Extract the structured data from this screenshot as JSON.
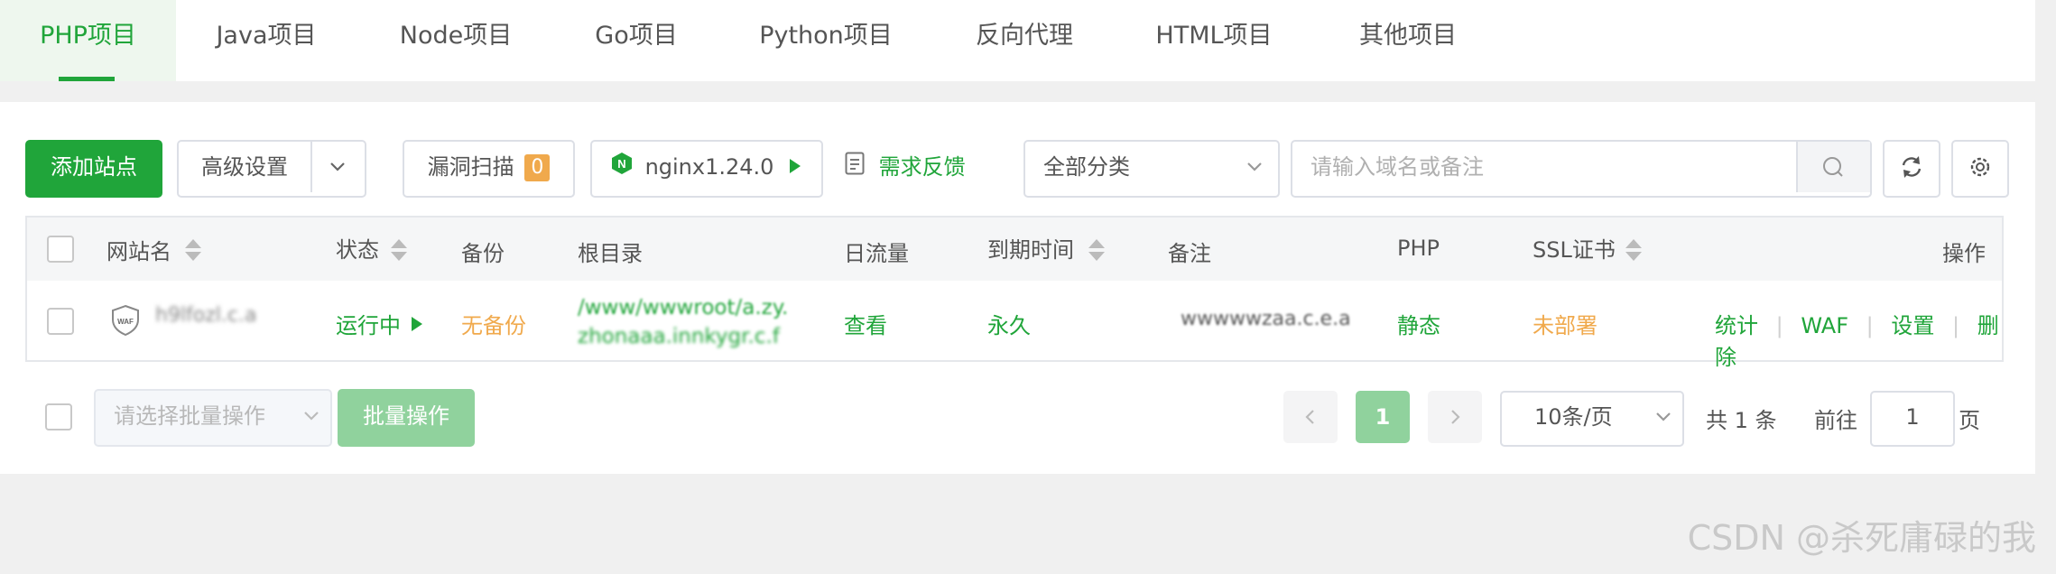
{
  "tabs": [
    "PHP项目",
    "Java项目",
    "Node项目",
    "Go项目",
    "Python项目",
    "反向代理",
    "HTML项目",
    "其他项目"
  ],
  "toolbar": {
    "add_site": "添加站点",
    "advanced": "高级设置",
    "vuln_scan": "漏洞扫描",
    "vuln_count": "0",
    "nginx": "nginx1.24.0",
    "feedback": "需求反馈",
    "category": "全部分类",
    "search_placeholder": "请输入域名或备注"
  },
  "table": {
    "headers": {
      "site_name": "网站名",
      "status": "状态",
      "backup": "备份",
      "root": "根目录",
      "traffic": "日流量",
      "expire": "到期时间",
      "remark": "备注",
      "php": "PHP",
      "ssl": "SSL证书",
      "actions": "操作"
    },
    "row": {
      "waf_badge": "WAF",
      "site_name": "h9lfozl.c.a",
      "status": "运行中",
      "backup": "无备份",
      "root_line1": "/www/wwwroot/a.zy.",
      "root_line2": "zhonaaa.innkygr.c.f",
      "traffic": "查看",
      "expire": "永久",
      "remark": "wwwwwzaa.c.e.a",
      "php": "静态",
      "ssl": "未部署",
      "action_stats": "统计",
      "action_waf": "WAF",
      "action_settings": "设置",
      "action_delete": "删除"
    }
  },
  "footer": {
    "batch_placeholder": "请选择批量操作",
    "batch_button": "批量操作",
    "current_page": "1",
    "per_page": "10条/页",
    "total": "共 1 条",
    "goto_label": "前往",
    "goto_value": "1",
    "page_suffix": "页"
  },
  "watermark": "CSDN @杀死庸碌的我",
  "colors": {
    "brand": "#20a53a",
    "warning": "#f0a94c",
    "header_bg": "#f5f6f7"
  }
}
